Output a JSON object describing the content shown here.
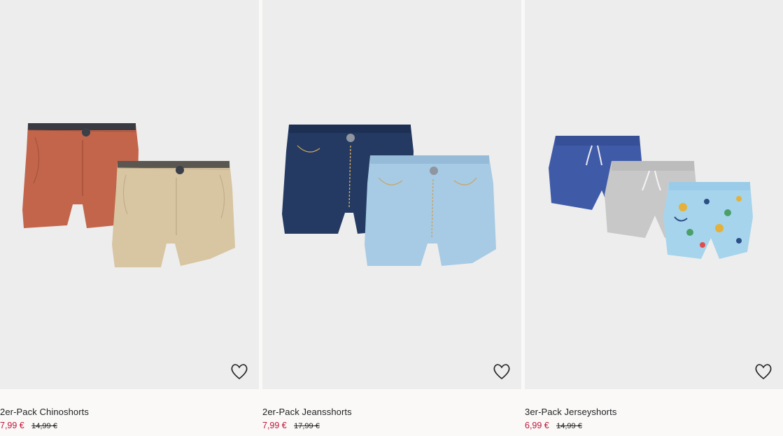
{
  "products": [
    {
      "name": "2er-Pack Chinoshorts",
      "sale_price": "7,99 €",
      "old_price": "14,99 €",
      "image_alt": "Two chino shorts, rust red and beige"
    },
    {
      "name": "2er-Pack Jeansshorts",
      "sale_price": "7,99 €",
      "old_price": "17,99 €",
      "image_alt": "Two denim shorts, dark blue and light blue"
    },
    {
      "name": "3er-Pack Jerseyshorts",
      "sale_price": "6,99 €",
      "old_price": "14,99 €",
      "image_alt": "Three jersey shorts, blue, grey and printed light blue"
    }
  ],
  "icons": {
    "favorite": "heart-outline-icon"
  },
  "colors": {
    "sale": "#c0183a",
    "text": "#222222",
    "image_bg": "#ededed",
    "page_bg": "#faf9f8"
  }
}
